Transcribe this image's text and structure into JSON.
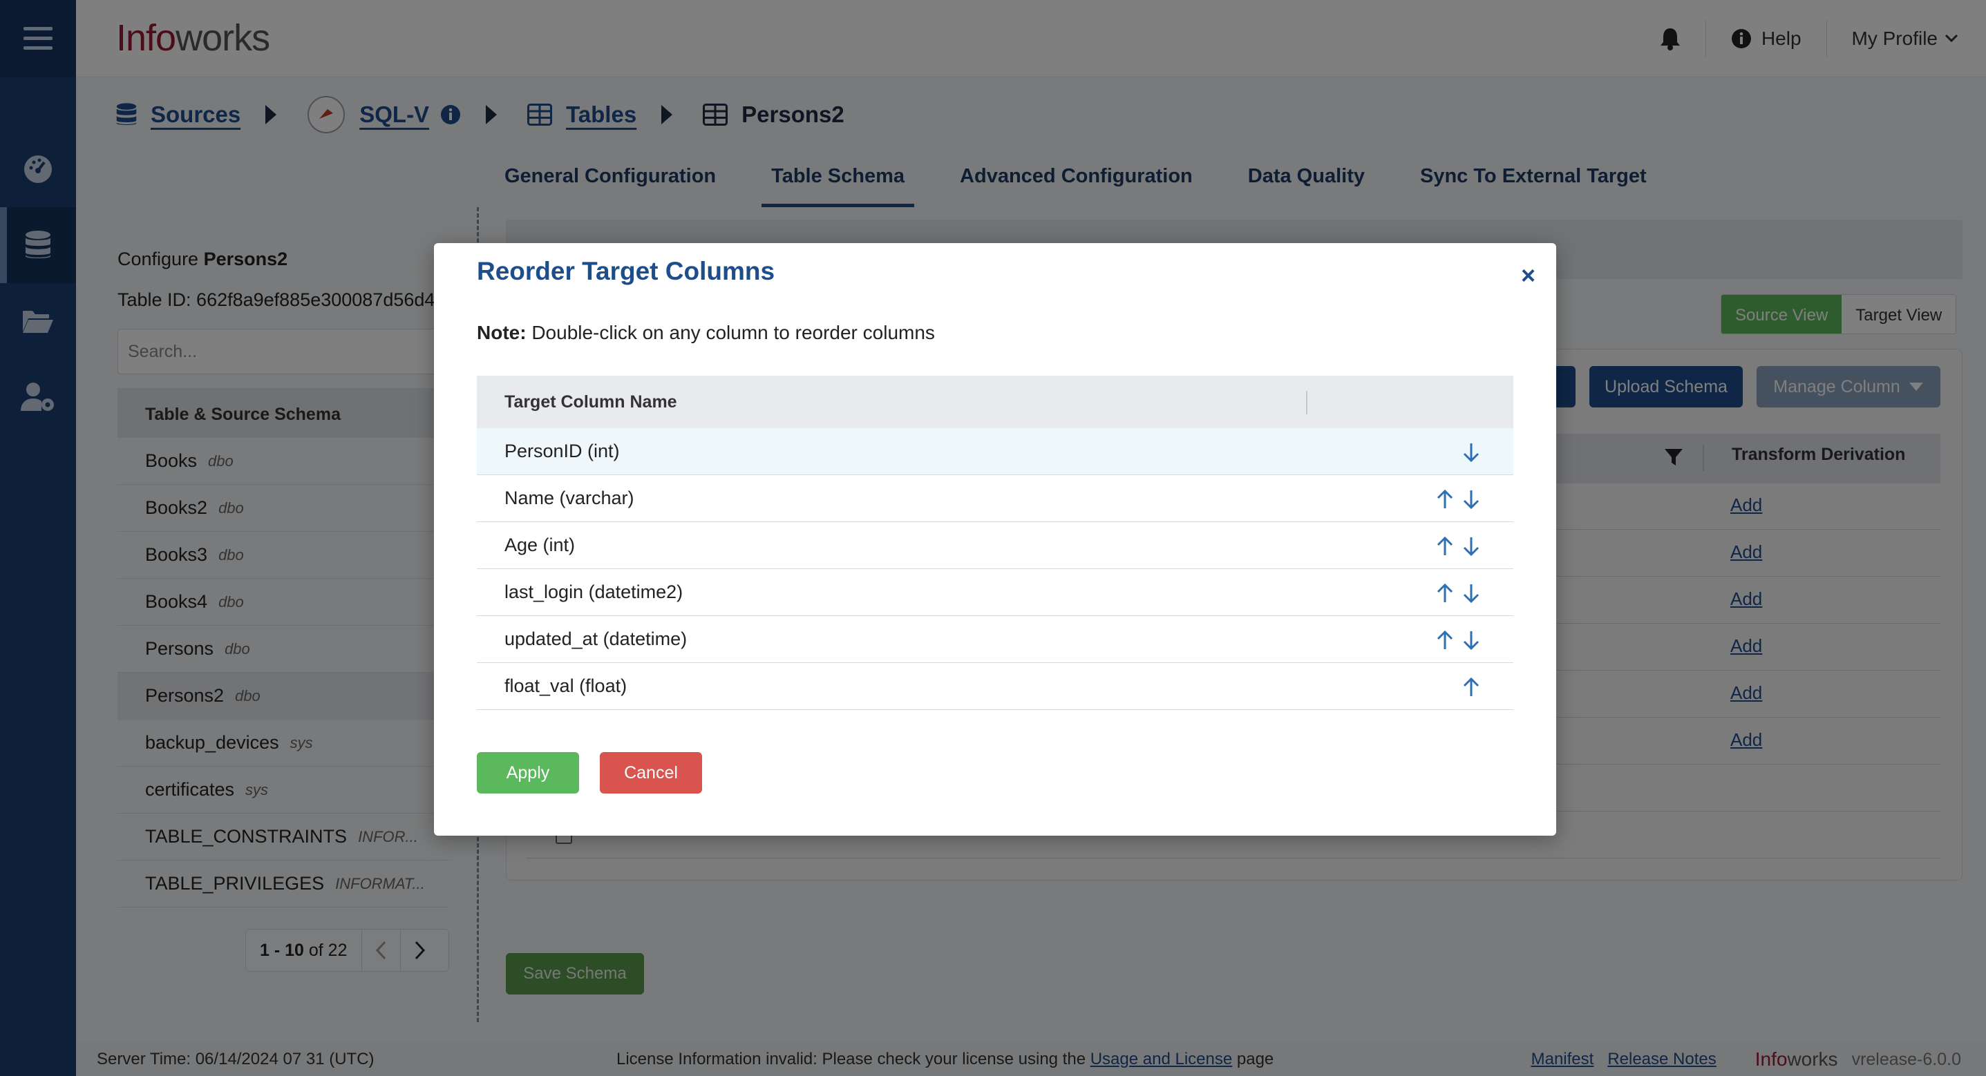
{
  "header": {
    "logo_red": "Info",
    "logo_gray": "works",
    "help_label": "Help",
    "profile_label": "My Profile"
  },
  "breadcrumb": {
    "sources": "Sources",
    "source_name": "SQL-V",
    "tables": "Tables",
    "current": "Persons2"
  },
  "tabs": [
    {
      "label": "General Configuration"
    },
    {
      "label": "Table Schema"
    },
    {
      "label": "Advanced Configuration"
    },
    {
      "label": "Data Quality"
    },
    {
      "label": "Sync To External Target"
    }
  ],
  "sidebar": {
    "configure_prefix": "Configure",
    "configure_name": "Persons2",
    "table_id": "Table ID: 662f8a9ef885e300087d56d4",
    "search_placeholder": "Search...",
    "list_header": "Table & Source Schema",
    "items": [
      {
        "name": "Books",
        "schema": "dbo"
      },
      {
        "name": "Books2",
        "schema": "dbo"
      },
      {
        "name": "Books3",
        "schema": "dbo"
      },
      {
        "name": "Books4",
        "schema": "dbo"
      },
      {
        "name": "Persons",
        "schema": "dbo"
      },
      {
        "name": "Persons2",
        "schema": "dbo"
      },
      {
        "name": "backup_devices",
        "schema": "sys"
      },
      {
        "name": "certificates",
        "schema": "sys"
      },
      {
        "name": "TABLE_CONSTRAINTS",
        "schema": "INFOR..."
      },
      {
        "name": "TABLE_PRIVILEGES",
        "schema": "INFORMAT..."
      }
    ],
    "pager_range": "1 - 10",
    "pager_of": "of 22"
  },
  "main": {
    "source_view": "Source View",
    "target_view": "Target View",
    "upload_schema": "Upload Schema",
    "manage_column": "Manage Column",
    "transform_header": "Transform Derivation",
    "add_label": "Add",
    "save_schema": "Save Schema"
  },
  "modal": {
    "title": "Reorder Target Columns",
    "close": "×",
    "note_bold": "Note:",
    "note_text": "Double-click on any column to reorder columns",
    "column_header": "Target Column Name",
    "rows": [
      {
        "name": "PersonID (int)"
      },
      {
        "name": "Name (varchar)"
      },
      {
        "name": "Age (int)"
      },
      {
        "name": "last_login (datetime2)"
      },
      {
        "name": "updated_at (datetime)"
      },
      {
        "name": "float_val (float)"
      }
    ],
    "apply": "Apply",
    "cancel": "Cancel"
  },
  "footer": {
    "server_time": "Server Time: 06/14/2024 07 31 (UTC)",
    "license_text": "License Information invalid: Please check your license using the",
    "license_link": "Usage and License",
    "license_suffix": "page",
    "manifest": "Manifest",
    "release_notes": "Release Notes",
    "brand_red": "Info",
    "brand_gray": "works",
    "version": "vrelease-6.0.0"
  },
  "colors": {
    "rail": "#1b3f73",
    "primary": "#1e4d8c",
    "logo": "#9b1b30",
    "success": "#5cb85c",
    "danger": "#d9534f"
  }
}
